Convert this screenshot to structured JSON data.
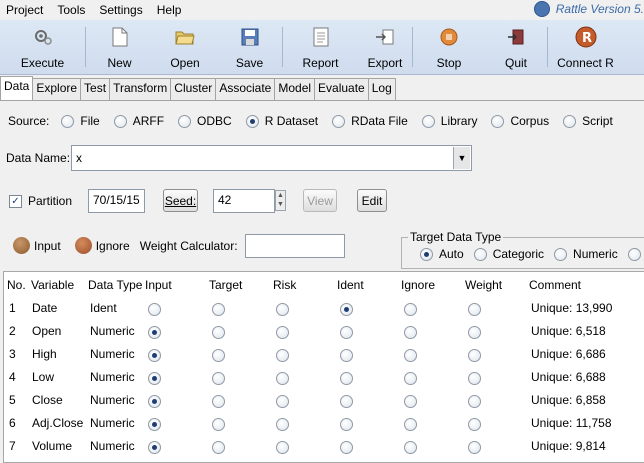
{
  "menu": {
    "items": [
      "Project",
      "Tools",
      "Settings",
      "Help"
    ],
    "brand": "Rattle Version 5."
  },
  "toolbar": {
    "buttons": [
      {
        "label": "Execute",
        "icon": "gears-icon"
      },
      {
        "label": "New",
        "icon": "new-document-icon"
      },
      {
        "label": "Open",
        "icon": "open-folder-icon"
      },
      {
        "label": "Save",
        "icon": "save-disk-icon"
      },
      {
        "label": "Report",
        "icon": "report-icon"
      },
      {
        "label": "Export",
        "icon": "export-icon"
      },
      {
        "label": "Stop",
        "icon": "stop-icon"
      },
      {
        "label": "Quit",
        "icon": "quit-icon"
      },
      {
        "label": "Connect R",
        "icon": "connect-r-icon"
      }
    ]
  },
  "tabs": [
    "Data",
    "Explore",
    "Test",
    "Transform",
    "Cluster",
    "Associate",
    "Model",
    "Evaluate",
    "Log"
  ],
  "source": {
    "label": "Source:",
    "options": [
      "File",
      "ARFF",
      "ODBC",
      "R Dataset",
      "RData File",
      "Library",
      "Corpus",
      "Script"
    ],
    "selected": "R Dataset"
  },
  "dataname": {
    "label": "Data Name:",
    "value": "x"
  },
  "partition": {
    "label": "Partition",
    "checked": true,
    "value": "70/15/15",
    "seed_label": "Seed:",
    "seed_value": "42",
    "view_label": "View",
    "edit_label": "Edit"
  },
  "roles": {
    "input_label": "Input",
    "ignore_label": "Ignore",
    "weight_label": "Weight Calculator:",
    "weight_value": ""
  },
  "target_type": {
    "legend": "Target Data Type",
    "options": [
      "Auto",
      "Categoric",
      "Numeric"
    ],
    "selected": "Auto"
  },
  "table": {
    "headers": [
      "No.",
      "Variable",
      "Data Type",
      "Input",
      "Target",
      "Risk",
      "Ident",
      "Ignore",
      "Weight",
      "Comment"
    ],
    "rows": [
      {
        "no": "1",
        "variable": "Date",
        "type": "Ident",
        "role": "Ident",
        "comment": "Unique: 13,990"
      },
      {
        "no": "2",
        "variable": "Open",
        "type": "Numeric",
        "role": "Input",
        "comment": "Unique: 6,518"
      },
      {
        "no": "3",
        "variable": "High",
        "type": "Numeric",
        "role": "Input",
        "comment": "Unique: 6,686"
      },
      {
        "no": "4",
        "variable": "Low",
        "type": "Numeric",
        "role": "Input",
        "comment": "Unique: 6,688"
      },
      {
        "no": "5",
        "variable": "Close",
        "type": "Numeric",
        "role": "Input",
        "comment": "Unique: 6,858"
      },
      {
        "no": "6",
        "variable": "Adj.Close",
        "type": "Numeric",
        "role": "Input",
        "comment": "Unique: 11,758"
      },
      {
        "no": "7",
        "variable": "Volume",
        "type": "Numeric",
        "role": "Input",
        "comment": "Unique: 9,814"
      }
    ]
  },
  "colors": {
    "accent": "#1f3d74",
    "input_dot": "#8a5a2b",
    "ignore_dot": "#9b4f2a",
    "brand": "#3b6aa8"
  }
}
